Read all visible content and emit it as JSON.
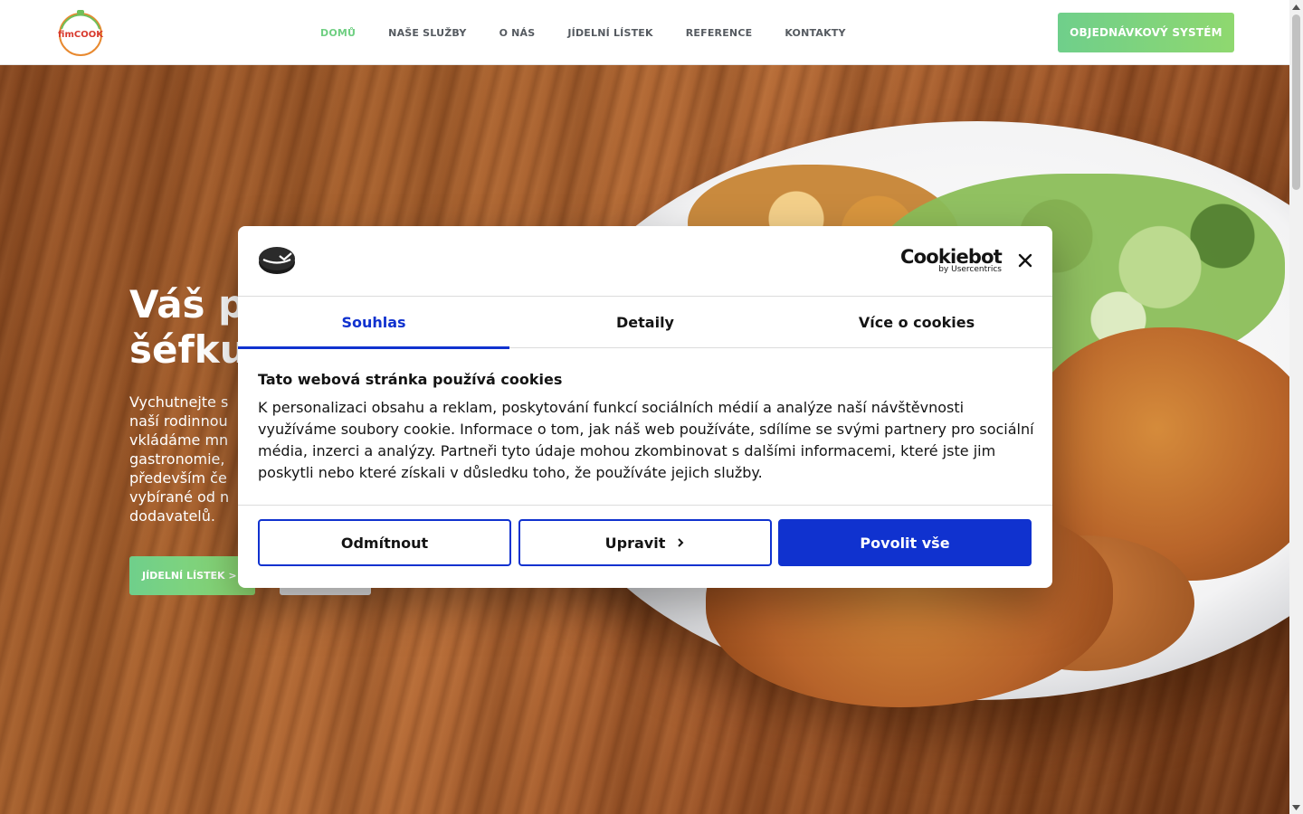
{
  "header": {
    "logo_text": "fimCOOK",
    "nav": [
      {
        "label": "DOMŮ",
        "active": true
      },
      {
        "label": "NAŠE SLUŽBY",
        "active": false
      },
      {
        "label": "O NÁS",
        "active": false
      },
      {
        "label": "JÍDELNÍ LÍSTEK",
        "active": false
      },
      {
        "label": "REFERENCE",
        "active": false
      },
      {
        "label": "KONTAKTY",
        "active": false
      }
    ],
    "order_button": "OBJEDNÁVKOVÝ SYSTÉM"
  },
  "hero": {
    "title": "Váš p\nšéfku",
    "text": "Vychutnejte s\nnaší rodinnou\nvkládáme mn\ngastronomie,\npředevším če\nvybírané od n\ndodavatelů.",
    "menu_button": "JÍDELNÍ LÍSTEK >"
  },
  "cookie_dialog": {
    "brand_main": "Cookiebot",
    "brand_sub": "by Usercentrics",
    "tabs": [
      {
        "label": "Souhlas",
        "active": true
      },
      {
        "label": "Detaily",
        "active": false
      },
      {
        "label": "Více o cookies",
        "active": false
      }
    ],
    "heading": "Tato webová stránka používá cookies",
    "body": "K personalizaci obsahu a reklam, poskytování funkcí sociálních médií a analýze naší návštěvnosti využíváme soubory cookie. Informace o tom, jak náš web používáte, sdílíme se svými partnery pro sociální média, inzerci a analýzy. Partneři tyto údaje mohou zkombinovat s dalšími informacemi, které jste jim poskytli nebo které získali v důsledku toho, že používáte jejich služby.",
    "buttons": {
      "deny": "Odmítnout",
      "customize": "Upravit",
      "allow_all": "Povolit vše"
    }
  },
  "colors": {
    "accent_green": "#6fcf8b",
    "cookiebot_blue": "#1032cf",
    "text_dark": "#141414"
  },
  "icons": [
    "fimcook-logo-icon",
    "cookiebot-logo-icon",
    "close-icon",
    "chevron-right-icon",
    "scroll-up-arrow-icon",
    "scroll-down-arrow-icon"
  ]
}
